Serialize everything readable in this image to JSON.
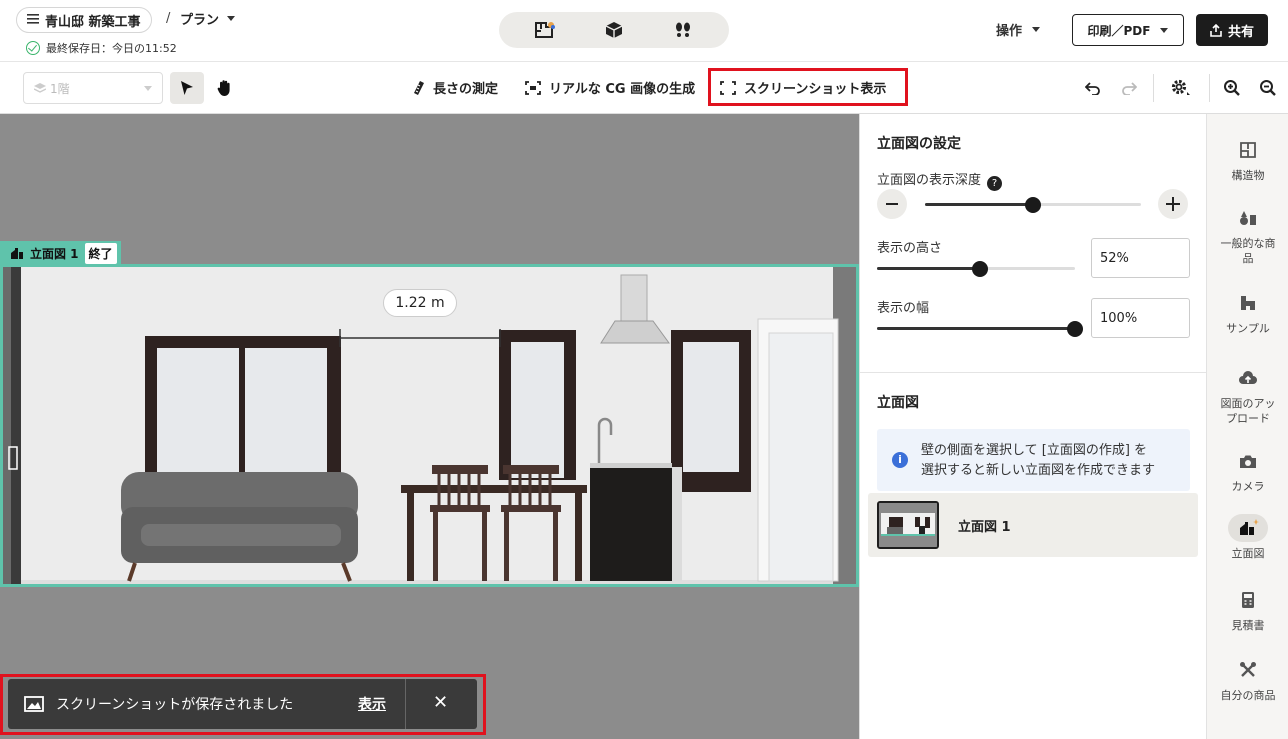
{
  "header": {
    "project_name": "青山邸 新築工事",
    "breadcrumb_sep": "/",
    "plan_label": "プラン",
    "save_status": "最終保存日：今日の11:52",
    "operations_label": "操作",
    "print_label": "印刷／PDF",
    "share_label": "共有"
  },
  "toolbar": {
    "floor": "1階",
    "measure_label": "長さの測定",
    "cg_label": "リアルな CG 画像の生成",
    "screenshot_label": "スクリーンショット表示"
  },
  "elevation": {
    "label": "立面図 1",
    "end_label": "終了",
    "dimension": "1.22 m"
  },
  "toast": {
    "message": "スクリーンショットが保存されました",
    "view_link": "表示",
    "close_glyph": "✕"
  },
  "panel": {
    "settings_title": "立面図の設定",
    "depth_label": "立面図の表示深度",
    "depth_value": 0.5,
    "help_glyph": "?",
    "height_label": "表示の高さ",
    "height_value": "52%",
    "height_fraction": 0.52,
    "width_label": "表示の幅",
    "width_value": "100%",
    "width_fraction": 1.0,
    "elevations_title": "立面図",
    "info_text_1": "壁の側面を選択して [立面図の作成] を",
    "info_text_2": "選択すると新しい立面図を作成できます",
    "info_glyph": "i",
    "item_label": "立面図 1"
  },
  "rail": {
    "structures": "構造物",
    "general_products_1": "一般的な商",
    "general_products_2": "品",
    "samples": "サンプル",
    "upload_1": "図面のアッ",
    "upload_2": "プロード",
    "camera": "カメラ",
    "elevation": "立面図",
    "estimate": "見積書",
    "my_products": "自分の商品"
  },
  "colors": {
    "accent_teal": "#5fc3ab",
    "highlight_red": "#e0121e",
    "dark": "#1c1c1c",
    "canvas_gray": "#8c8c8c"
  }
}
